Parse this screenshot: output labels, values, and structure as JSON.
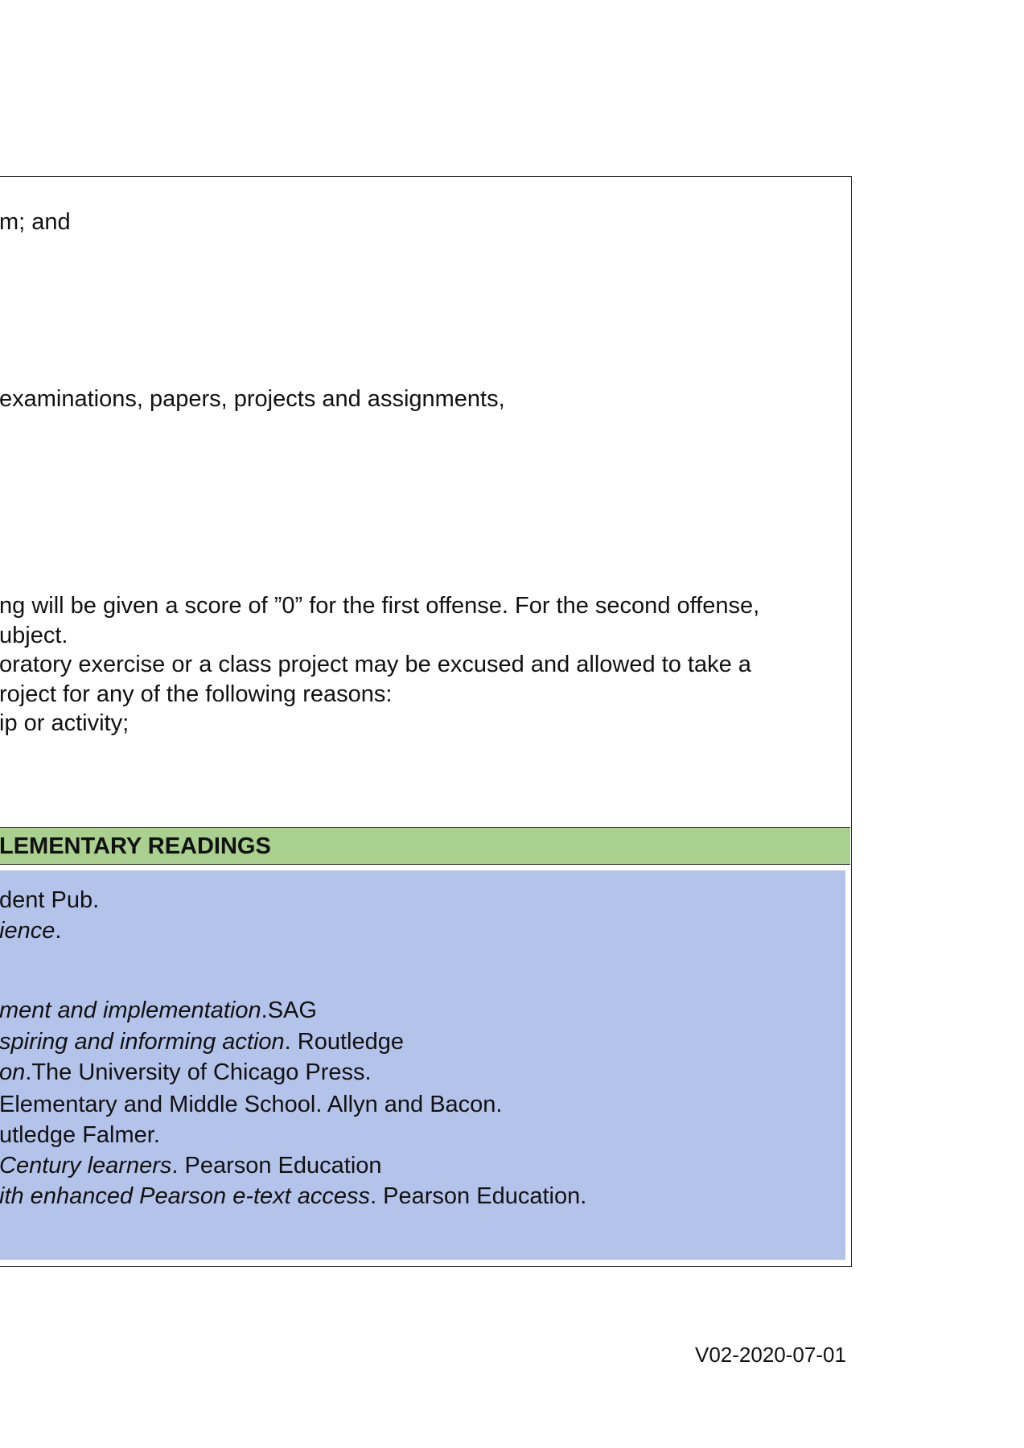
{
  "policy_lines": [
    "m; and",
    " examinations, papers, projects and assignments,",
    "ng will be given a score of ”0” for the first offense. For the second offense,",
    "ubject.",
    "oratory exercise or a class project may be excused and allowed to take a",
    "roject for any of the following reasons:",
    "ip or activity;"
  ],
  "section_header": "LEMENTARY READINGS",
  "references": [
    {
      "italic": "",
      "plain": "dent Pub."
    },
    {
      "italic": "ience",
      "plain": "."
    },
    {
      "italic": "ment and implementation",
      "plain": ".SAG"
    },
    {
      "italic": "spiring and informing action",
      "plain": ". Routledge"
    },
    {
      "italic": "on",
      "plain": ".The University of Chicago Press."
    },
    {
      "italic": "",
      "plain": "Elementary and Middle School. Allyn and Bacon."
    },
    {
      "italic": "",
      "plain": "utledge Falmer."
    },
    {
      "italic": "Century learners",
      "plain": ". Pearson Education"
    },
    {
      "italic": "ith enhanced Pearson e-text access",
      "plain": ". Pearson Education."
    }
  ],
  "footer_version": "V02-2020-07-01",
  "colors": {
    "section_header_bg": "#a9d08e",
    "readings_bg": "#b4c3ea"
  }
}
